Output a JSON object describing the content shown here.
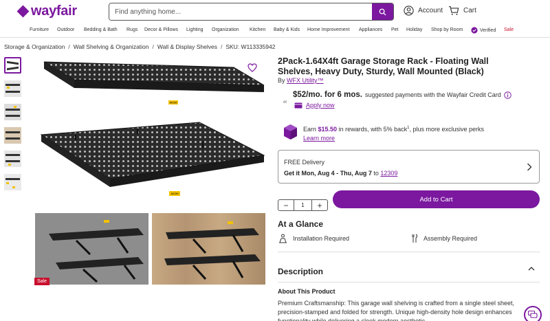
{
  "header": {
    "logo_text": "wayfair",
    "search_placeholder": "Find anything home...",
    "account_label": "Account",
    "cart_label": "Cart",
    "brand_color": "#7b189f"
  },
  "nav": {
    "items": [
      "Furniture",
      "Outdoor",
      "Bedding & Bath",
      "Rugs",
      "Decor & Pillows",
      "Lighting",
      "Organization",
      "Kitchen",
      "Baby & Kids",
      "Home Improvement",
      "Appliances",
      "Pet",
      "Holiday",
      "Shop by Room"
    ],
    "verified_label": "Verified",
    "sale_label": "Sale"
  },
  "breadcrumb": {
    "items": [
      "Storage & Organization",
      "Wall Shelving & Organization",
      "Wall & Display Shelves"
    ],
    "sku": "SKU: W113335942"
  },
  "gallery": {
    "sale_badge": "Sale",
    "brand_tag": "AKOM"
  },
  "product": {
    "title": "2Pack-1.64X4ft Garage Storage Rack - Floating Wall Shelves, Heavy Duty, Sturdy, Wall Mounted (Black)",
    "by_prefix": "By",
    "brand": "WFX Utility™"
  },
  "financing": {
    "amount": "$52/mo. for 6 mos.",
    "text": "suggested payments with the Wayfair Credit Card",
    "or": "or",
    "apply_label": "Apply now"
  },
  "rewards": {
    "prefix": "Earn",
    "amount": "$15.50",
    "suffix": "in rewards, with 5% back",
    "sup": "1",
    "suffix2": ", plus more exclusive perks",
    "learn_more": "Learn more"
  },
  "delivery": {
    "label": "FREE Delivery",
    "date_prefix": "Get it",
    "dates": "Mon, Aug 4 - Thu, Aug 7",
    "to": "to",
    "zip": "12309"
  },
  "purchase": {
    "quantity": "1",
    "minus": "−",
    "plus": "+",
    "add_to_cart": "Add to Cart"
  },
  "glance": {
    "heading": "At a Glance",
    "installation": "Installation Required",
    "assembly": "Assembly Required"
  },
  "description": {
    "heading": "Description",
    "about": "About This Product",
    "body": "Premium Craftsmanship: This garage wall shelving is crafted from a single steel sheet, precision-stamped and folded for strength. Unique high-density hole design enhances functionality while delivering a sleek modern aesthetic."
  }
}
